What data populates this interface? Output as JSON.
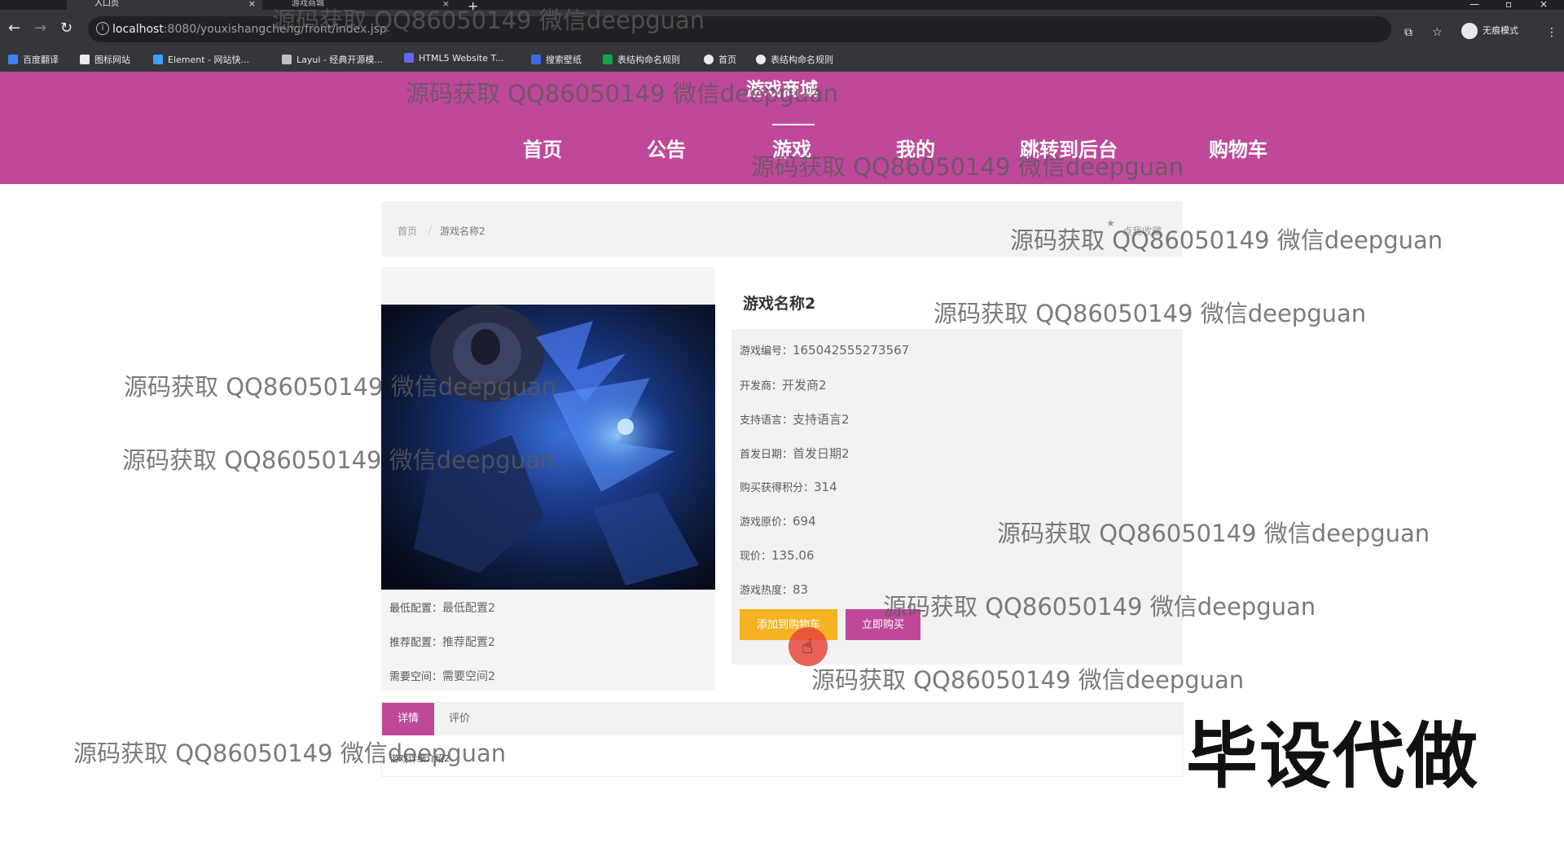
{
  "browser": {
    "tabs": [
      {
        "title": "入口页",
        "active": true
      },
      {
        "title": "游戏商城",
        "active": false
      }
    ],
    "url_host": "localhost",
    "url_path": ":8080/youxishangcheng/front/index.jsp",
    "incognito_label": "无痕模式",
    "bookmarks": [
      "百度翻译",
      "图标网站",
      "Element - 网站快...",
      "Layui - 经典开源模...",
      "HTML5 Website T...",
      "搜索壁纸",
      "表结构命名规则",
      "首页",
      "表结构命名规则"
    ]
  },
  "site": {
    "title": "游戏商城",
    "nav": [
      "首页",
      "公告",
      "游戏",
      "我的",
      "跳转到后台",
      "购物车"
    ],
    "active_nav": "游戏"
  },
  "breadcrumb": {
    "home": "首页",
    "separator": "/",
    "current": "游戏名称2",
    "favorite": "点我收藏"
  },
  "game": {
    "name": "游戏名称2",
    "details": [
      {
        "label": "游戏编号：",
        "value": "165042555273567"
      },
      {
        "label": "开发商：",
        "value": "开发商2"
      },
      {
        "label": "支持语言：",
        "value": "支持语言2"
      },
      {
        "label": "首发日期：",
        "value": "首发日期2"
      },
      {
        "label": "购买获得积分：",
        "value": "314"
      },
      {
        "label": "游戏原价：",
        "value": "694"
      },
      {
        "label": "现价：",
        "value": "135.06"
      },
      {
        "label": "游戏热度：",
        "value": "83"
      }
    ],
    "config": [
      {
        "label": "最低配置：",
        "value": "最低配置2"
      },
      {
        "label": "推荐配置：",
        "value": "推荐配置2"
      },
      {
        "label": "需要空间：",
        "value": "需要空间2"
      }
    ],
    "add_to_cart": "添加到购物车",
    "buy_now": "立即购买"
  },
  "tabs": {
    "detail": "详情",
    "review": "评价",
    "detail_text": "游戏详细介绍2"
  },
  "watermark": "源码获取 QQ86050149 微信deepguan",
  "promo": "毕设代做",
  "colors": {
    "brand": "#c0489b",
    "cart_button": "#f5b324"
  }
}
